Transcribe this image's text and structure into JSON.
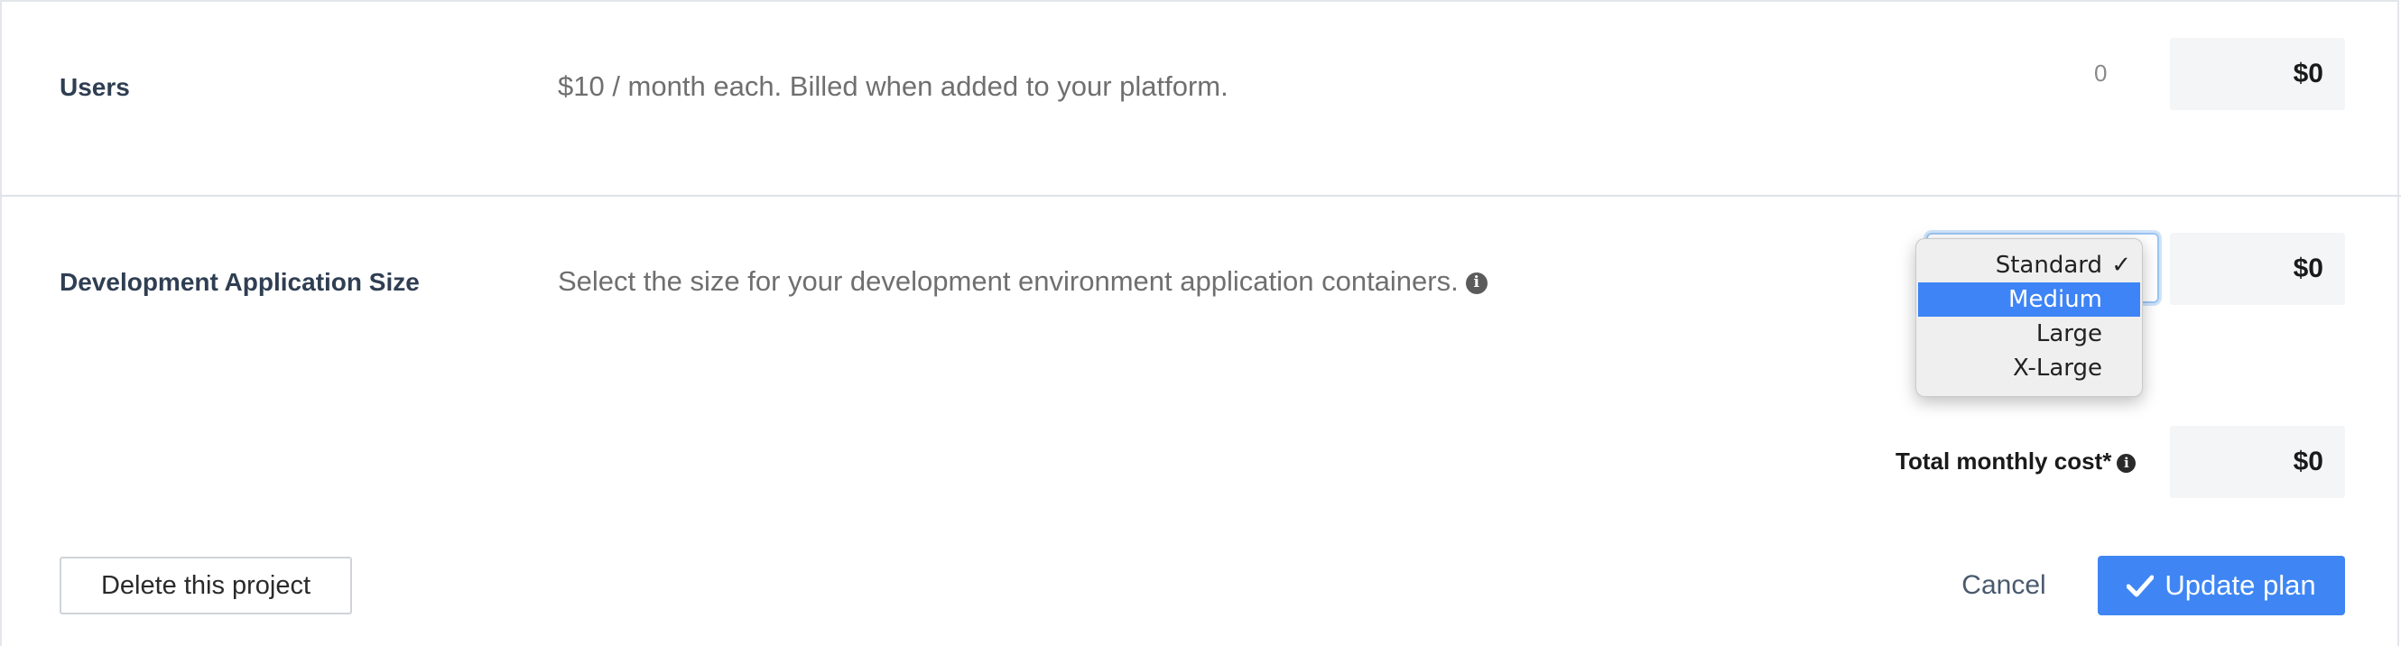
{
  "users_row": {
    "title": "Users",
    "description": "$10 / month each. Billed when added to your platform.",
    "quantity": "0",
    "price": "$0"
  },
  "dev_app_row": {
    "title": "Development Application Size",
    "description": "Select the size for your development environment application containers.",
    "price": "$0",
    "dropdown": {
      "options": [
        "Standard",
        "Medium",
        "Large",
        "X-Large"
      ],
      "checked": "Standard",
      "highlighted": "Medium"
    }
  },
  "total": {
    "label": "Total monthly cost*",
    "price": "$0"
  },
  "actions": {
    "delete_label": "Delete this project",
    "cancel_label": "Cancel",
    "update_label": "Update plan"
  },
  "colors": {
    "primary": "#3f86f4",
    "highlight": "#3e84f7",
    "title": "#2f3e52"
  },
  "icons": {
    "info": "info-icon",
    "check": "check-icon"
  }
}
